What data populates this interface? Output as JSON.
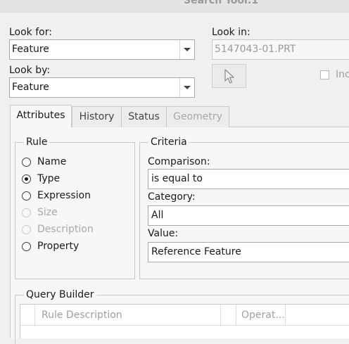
{
  "window": {
    "title": "Search Tool:1"
  },
  "look_for": {
    "label": "Look for:",
    "value": "Feature"
  },
  "look_by": {
    "label": "Look by:",
    "value": "Feature"
  },
  "look_in": {
    "label": "Look in:",
    "value": "5147043-01.PRT"
  },
  "include_checkbox": {
    "label": "Inc",
    "checked": false
  },
  "tabs": [
    {
      "label": "Attributes",
      "state": "active"
    },
    {
      "label": "History",
      "state": "normal"
    },
    {
      "label": "Status",
      "state": "normal"
    },
    {
      "label": "Geometry",
      "state": "disabled"
    }
  ],
  "rule": {
    "title": "Rule",
    "options": [
      {
        "label": "Name",
        "state": "unchecked"
      },
      {
        "label": "Type",
        "state": "checked"
      },
      {
        "label": "Expression",
        "state": "unchecked"
      },
      {
        "label": "Size",
        "state": "disabled"
      },
      {
        "label": "Description",
        "state": "disabled"
      },
      {
        "label": "Property",
        "state": "unchecked"
      }
    ]
  },
  "criteria": {
    "title": "Criteria",
    "comparison_label": "Comparison:",
    "comparison_value": "is equal to",
    "category_label": "Category:",
    "category_value": "All",
    "value_label": "Value:",
    "value_value": "Reference Feature"
  },
  "query_builder": {
    "title": "Query Builder",
    "columns": [
      "Rule Description",
      "Operat..."
    ]
  }
}
